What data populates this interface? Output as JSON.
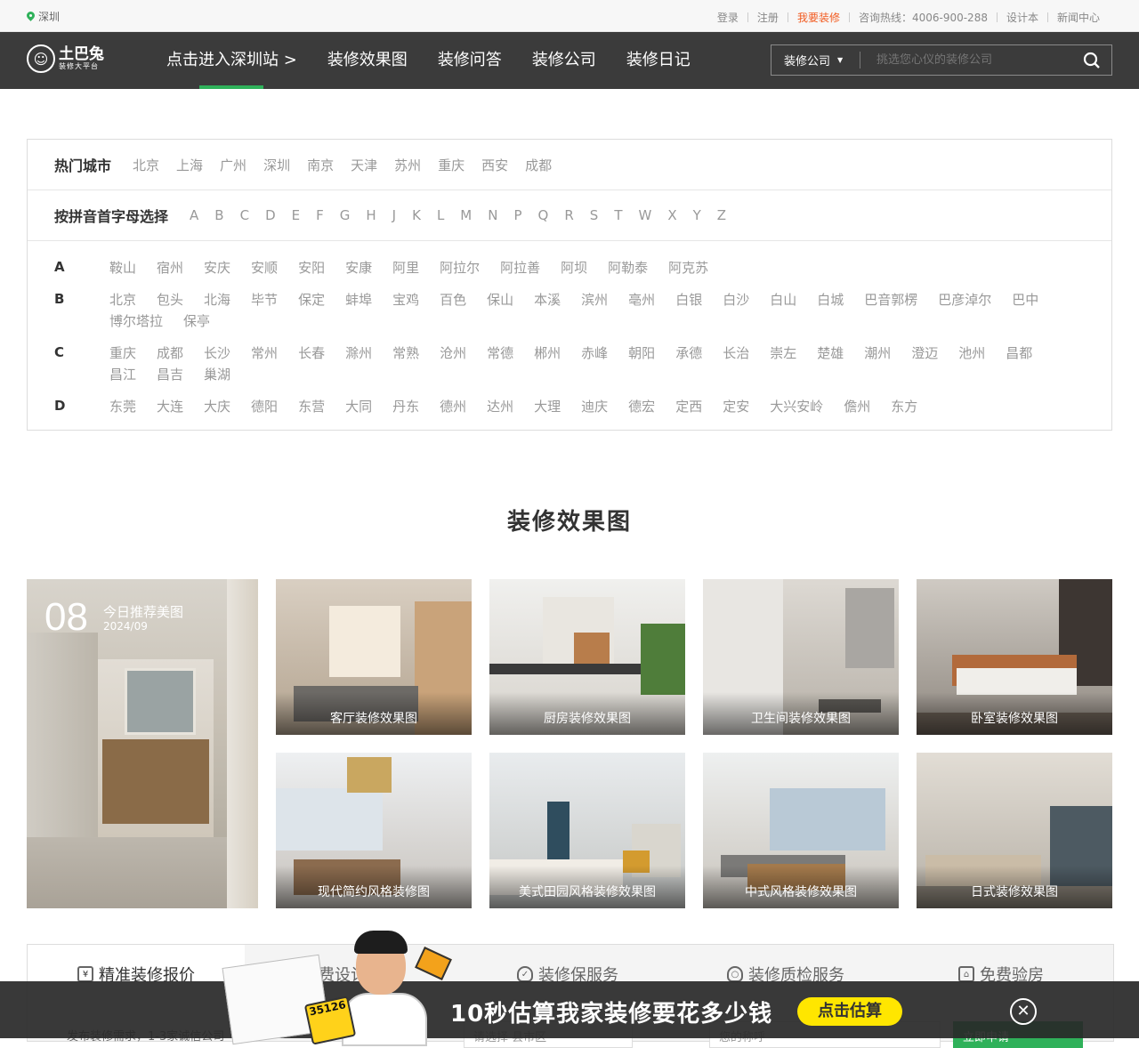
{
  "topbar": {
    "location": "深圳",
    "links": [
      "登录",
      "注册",
      "我要装修",
      "咨询热线：4006-900-288",
      "设计本",
      "新闻中心"
    ],
    "highlight": "我要装修"
  },
  "logo": {
    "name": "土巴兔",
    "tagline": "装修大平台"
  },
  "nav": {
    "items": [
      "点击进入深圳站 >",
      "装修效果图",
      "装修问答",
      "装修公司",
      "装修日记"
    ],
    "active": "点击进入深圳站 >"
  },
  "search": {
    "category": "装修公司",
    "placeholder": "挑选您心仪的装修公司",
    "icon": "search-icon"
  },
  "cities": {
    "hot_label": "热门城市",
    "hot": [
      "北京",
      "上海",
      "广州",
      "深圳",
      "南京",
      "天津",
      "苏州",
      "重庆",
      "西安",
      "成都"
    ],
    "pinyin_label": "按拼音首字母选择",
    "letters": [
      "A",
      "B",
      "C",
      "D",
      "E",
      "F",
      "G",
      "H",
      "J",
      "K",
      "L",
      "M",
      "N",
      "P",
      "Q",
      "R",
      "S",
      "T",
      "W",
      "X",
      "Y",
      "Z"
    ],
    "groups": [
      {
        "letter": "A",
        "cities": [
          "鞍山",
          "宿州",
          "安庆",
          "安顺",
          "安阳",
          "安康",
          "阿里",
          "阿拉尔",
          "阿拉善",
          "阿坝",
          "阿勒泰",
          "阿克苏"
        ]
      },
      {
        "letter": "B",
        "cities": [
          "北京",
          "包头",
          "北海",
          "毕节",
          "保定",
          "蚌埠",
          "宝鸡",
          "百色",
          "保山",
          "本溪",
          "滨州",
          "亳州",
          "白银",
          "白沙",
          "白山",
          "白城",
          "巴音郭楞",
          "巴彦淖尔",
          "巴中",
          "博尔塔拉",
          "保亭"
        ]
      },
      {
        "letter": "C",
        "cities": [
          "重庆",
          "成都",
          "长沙",
          "常州",
          "长春",
          "滁州",
          "常熟",
          "沧州",
          "常德",
          "郴州",
          "赤峰",
          "朝阳",
          "承德",
          "长治",
          "崇左",
          "楚雄",
          "潮州",
          "澄迈",
          "池州",
          "昌都",
          "昌江",
          "昌吉",
          "巢湖"
        ]
      },
      {
        "letter": "D",
        "cities": [
          "东莞",
          "大连",
          "大庆",
          "德阳",
          "东营",
          "大同",
          "丹东",
          "德州",
          "达州",
          "大理",
          "迪庆",
          "德宏",
          "定西",
          "定安",
          "大兴安岭",
          "儋州",
          "东方"
        ]
      }
    ]
  },
  "section_title": "装修效果图",
  "featured": {
    "day": "08",
    "title": "今日推荐美图",
    "date": "2024/09"
  },
  "tiles": [
    "客厅装修效果图",
    "厨房装修效果图",
    "卫生间装修效果图",
    "卧室装修效果图",
    "现代简约风格装修图",
    "美式田园风格装修效果图",
    "中式风格装修效果图",
    "日式装修效果图"
  ],
  "tabs": [
    "精准装修报价",
    "免费设计方案",
    "装修保服务",
    "装修质检服务",
    "免费验房"
  ],
  "tab_body": "发布装修需求，1-3家诚信公司",
  "tab_inputs": [
    "请选择 县市区",
    "您的称呼",
    "立即申请"
  ],
  "ad": {
    "text": "10秒估算我家装修要花多少钱",
    "button": "点击估算",
    "calc_number": "35126"
  }
}
